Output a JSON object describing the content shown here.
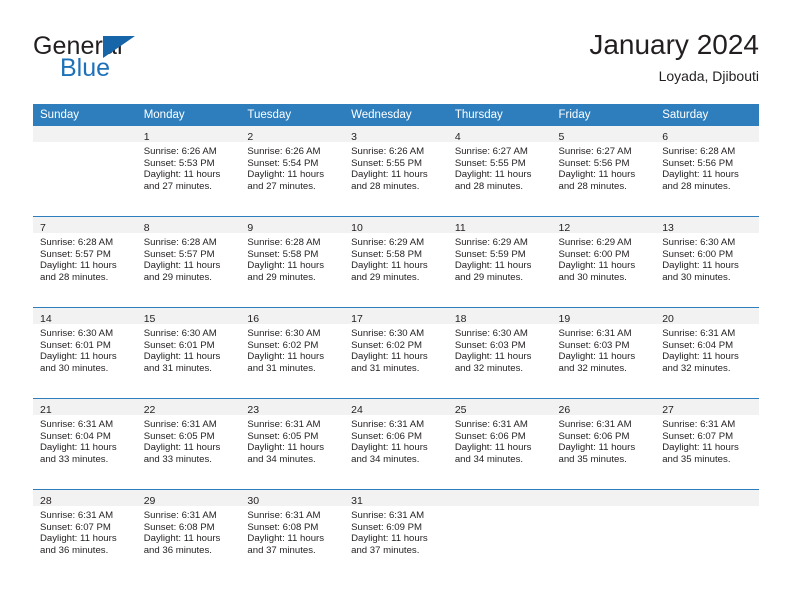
{
  "brand": {
    "name_top": "General",
    "name_bottom": "Blue",
    "logo_icon": "triangle-logo-icon",
    "accent_color": "#1565a8"
  },
  "header": {
    "title": "January 2024",
    "subtitle": "Loyada, Djibouti"
  },
  "calendar": {
    "header_bg": "#2e7ebd",
    "daynum_bg": "#f2f2f2",
    "weekdays": [
      "Sunday",
      "Monday",
      "Tuesday",
      "Wednesday",
      "Thursday",
      "Friday",
      "Saturday"
    ],
    "weeks": [
      [
        {
          "day": "",
          "sunrise": "",
          "sunset": "",
          "daylight1": "",
          "daylight2": ""
        },
        {
          "day": "1",
          "sunrise": "Sunrise: 6:26 AM",
          "sunset": "Sunset: 5:53 PM",
          "daylight1": "Daylight: 11 hours",
          "daylight2": "and 27 minutes."
        },
        {
          "day": "2",
          "sunrise": "Sunrise: 6:26 AM",
          "sunset": "Sunset: 5:54 PM",
          "daylight1": "Daylight: 11 hours",
          "daylight2": "and 27 minutes."
        },
        {
          "day": "3",
          "sunrise": "Sunrise: 6:26 AM",
          "sunset": "Sunset: 5:55 PM",
          "daylight1": "Daylight: 11 hours",
          "daylight2": "and 28 minutes."
        },
        {
          "day": "4",
          "sunrise": "Sunrise: 6:27 AM",
          "sunset": "Sunset: 5:55 PM",
          "daylight1": "Daylight: 11 hours",
          "daylight2": "and 28 minutes."
        },
        {
          "day": "5",
          "sunrise": "Sunrise: 6:27 AM",
          "sunset": "Sunset: 5:56 PM",
          "daylight1": "Daylight: 11 hours",
          "daylight2": "and 28 minutes."
        },
        {
          "day": "6",
          "sunrise": "Sunrise: 6:28 AM",
          "sunset": "Sunset: 5:56 PM",
          "daylight1": "Daylight: 11 hours",
          "daylight2": "and 28 minutes."
        }
      ],
      [
        {
          "day": "7",
          "sunrise": "Sunrise: 6:28 AM",
          "sunset": "Sunset: 5:57 PM",
          "daylight1": "Daylight: 11 hours",
          "daylight2": "and 28 minutes."
        },
        {
          "day": "8",
          "sunrise": "Sunrise: 6:28 AM",
          "sunset": "Sunset: 5:57 PM",
          "daylight1": "Daylight: 11 hours",
          "daylight2": "and 29 minutes."
        },
        {
          "day": "9",
          "sunrise": "Sunrise: 6:28 AM",
          "sunset": "Sunset: 5:58 PM",
          "daylight1": "Daylight: 11 hours",
          "daylight2": "and 29 minutes."
        },
        {
          "day": "10",
          "sunrise": "Sunrise: 6:29 AM",
          "sunset": "Sunset: 5:58 PM",
          "daylight1": "Daylight: 11 hours",
          "daylight2": "and 29 minutes."
        },
        {
          "day": "11",
          "sunrise": "Sunrise: 6:29 AM",
          "sunset": "Sunset: 5:59 PM",
          "daylight1": "Daylight: 11 hours",
          "daylight2": "and 29 minutes."
        },
        {
          "day": "12",
          "sunrise": "Sunrise: 6:29 AM",
          "sunset": "Sunset: 6:00 PM",
          "daylight1": "Daylight: 11 hours",
          "daylight2": "and 30 minutes."
        },
        {
          "day": "13",
          "sunrise": "Sunrise: 6:30 AM",
          "sunset": "Sunset: 6:00 PM",
          "daylight1": "Daylight: 11 hours",
          "daylight2": "and 30 minutes."
        }
      ],
      [
        {
          "day": "14",
          "sunrise": "Sunrise: 6:30 AM",
          "sunset": "Sunset: 6:01 PM",
          "daylight1": "Daylight: 11 hours",
          "daylight2": "and 30 minutes."
        },
        {
          "day": "15",
          "sunrise": "Sunrise: 6:30 AM",
          "sunset": "Sunset: 6:01 PM",
          "daylight1": "Daylight: 11 hours",
          "daylight2": "and 31 minutes."
        },
        {
          "day": "16",
          "sunrise": "Sunrise: 6:30 AM",
          "sunset": "Sunset: 6:02 PM",
          "daylight1": "Daylight: 11 hours",
          "daylight2": "and 31 minutes."
        },
        {
          "day": "17",
          "sunrise": "Sunrise: 6:30 AM",
          "sunset": "Sunset: 6:02 PM",
          "daylight1": "Daylight: 11 hours",
          "daylight2": "and 31 minutes."
        },
        {
          "day": "18",
          "sunrise": "Sunrise: 6:30 AM",
          "sunset": "Sunset: 6:03 PM",
          "daylight1": "Daylight: 11 hours",
          "daylight2": "and 32 minutes."
        },
        {
          "day": "19",
          "sunrise": "Sunrise: 6:31 AM",
          "sunset": "Sunset: 6:03 PM",
          "daylight1": "Daylight: 11 hours",
          "daylight2": "and 32 minutes."
        },
        {
          "day": "20",
          "sunrise": "Sunrise: 6:31 AM",
          "sunset": "Sunset: 6:04 PM",
          "daylight1": "Daylight: 11 hours",
          "daylight2": "and 32 minutes."
        }
      ],
      [
        {
          "day": "21",
          "sunrise": "Sunrise: 6:31 AM",
          "sunset": "Sunset: 6:04 PM",
          "daylight1": "Daylight: 11 hours",
          "daylight2": "and 33 minutes."
        },
        {
          "day": "22",
          "sunrise": "Sunrise: 6:31 AM",
          "sunset": "Sunset: 6:05 PM",
          "daylight1": "Daylight: 11 hours",
          "daylight2": "and 33 minutes."
        },
        {
          "day": "23",
          "sunrise": "Sunrise: 6:31 AM",
          "sunset": "Sunset: 6:05 PM",
          "daylight1": "Daylight: 11 hours",
          "daylight2": "and 34 minutes."
        },
        {
          "day": "24",
          "sunrise": "Sunrise: 6:31 AM",
          "sunset": "Sunset: 6:06 PM",
          "daylight1": "Daylight: 11 hours",
          "daylight2": "and 34 minutes."
        },
        {
          "day": "25",
          "sunrise": "Sunrise: 6:31 AM",
          "sunset": "Sunset: 6:06 PM",
          "daylight1": "Daylight: 11 hours",
          "daylight2": "and 34 minutes."
        },
        {
          "day": "26",
          "sunrise": "Sunrise: 6:31 AM",
          "sunset": "Sunset: 6:06 PM",
          "daylight1": "Daylight: 11 hours",
          "daylight2": "and 35 minutes."
        },
        {
          "day": "27",
          "sunrise": "Sunrise: 6:31 AM",
          "sunset": "Sunset: 6:07 PM",
          "daylight1": "Daylight: 11 hours",
          "daylight2": "and 35 minutes."
        }
      ],
      [
        {
          "day": "28",
          "sunrise": "Sunrise: 6:31 AM",
          "sunset": "Sunset: 6:07 PM",
          "daylight1": "Daylight: 11 hours",
          "daylight2": "and 36 minutes."
        },
        {
          "day": "29",
          "sunrise": "Sunrise: 6:31 AM",
          "sunset": "Sunset: 6:08 PM",
          "daylight1": "Daylight: 11 hours",
          "daylight2": "and 36 minutes."
        },
        {
          "day": "30",
          "sunrise": "Sunrise: 6:31 AM",
          "sunset": "Sunset: 6:08 PM",
          "daylight1": "Daylight: 11 hours",
          "daylight2": "and 37 minutes."
        },
        {
          "day": "31",
          "sunrise": "Sunrise: 6:31 AM",
          "sunset": "Sunset: 6:09 PM",
          "daylight1": "Daylight: 11 hours",
          "daylight2": "and 37 minutes."
        },
        {
          "day": "",
          "sunrise": "",
          "sunset": "",
          "daylight1": "",
          "daylight2": ""
        },
        {
          "day": "",
          "sunrise": "",
          "sunset": "",
          "daylight1": "",
          "daylight2": ""
        },
        {
          "day": "",
          "sunrise": "",
          "sunset": "",
          "daylight1": "",
          "daylight2": ""
        }
      ]
    ]
  }
}
